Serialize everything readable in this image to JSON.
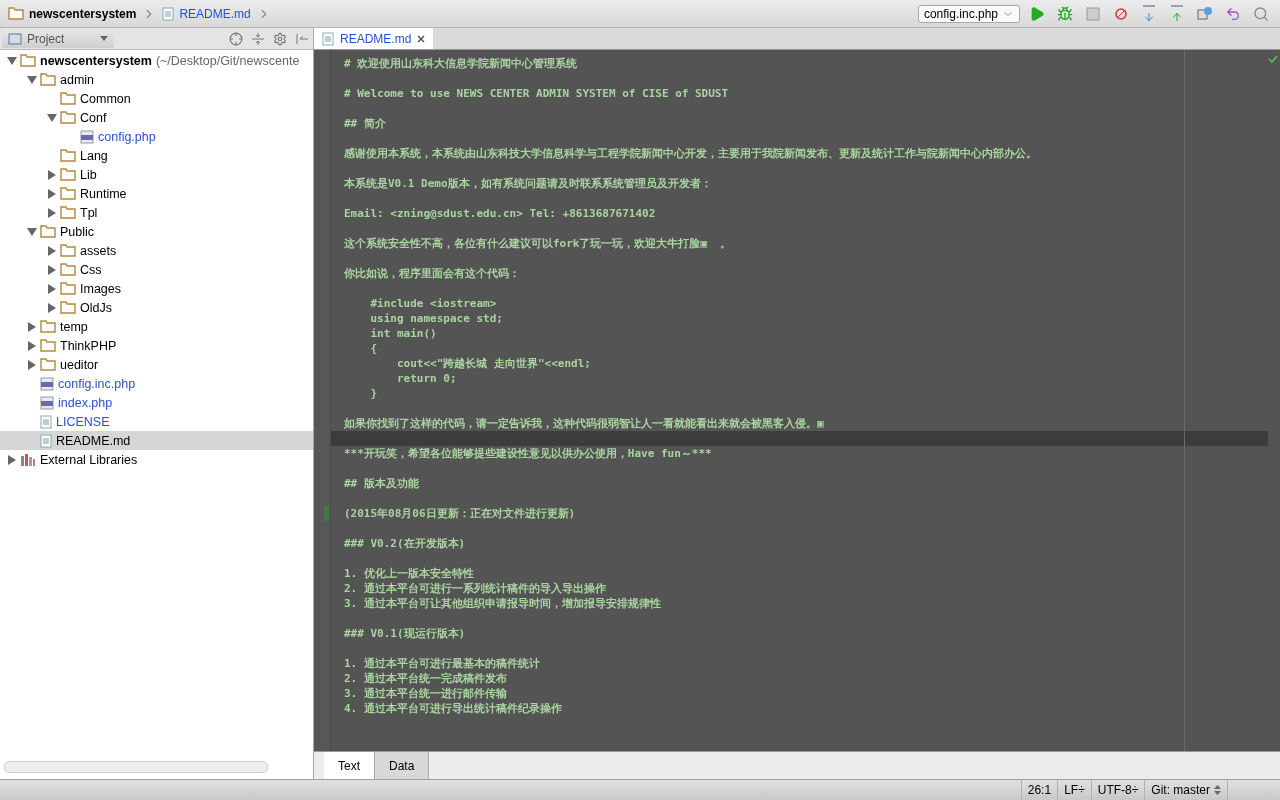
{
  "breadcrumb": [
    {
      "label": "newscentersystem",
      "kind": "folder"
    },
    {
      "label": "README.md",
      "kind": "file"
    }
  ],
  "run_config": {
    "label": "config.inc.php"
  },
  "project_panel": {
    "title": "Project"
  },
  "tree": [
    {
      "label": "newscentersystem",
      "path": "(~/Desktop/Git/newscente",
      "kind": "root",
      "expanded": true,
      "selected": false,
      "children": [
        {
          "label": "admin",
          "kind": "folder",
          "expanded": true,
          "selected": false,
          "children": [
            {
              "label": "Common",
              "kind": "folder",
              "selected": false
            },
            {
              "label": "Conf",
              "kind": "folder",
              "expanded": true,
              "selected": false,
              "children": [
                {
                  "label": "config.php",
                  "kind": "php",
                  "selected": false
                }
              ]
            },
            {
              "label": "Lang",
              "kind": "folder",
              "selected": false
            },
            {
              "label": "Lib",
              "kind": "folder",
              "expanded": false,
              "selected": false
            },
            {
              "label": "Runtime",
              "kind": "folder",
              "expanded": false,
              "selected": false
            },
            {
              "label": "Tpl",
              "kind": "folder",
              "expanded": false,
              "selected": false
            }
          ]
        },
        {
          "label": "Public",
          "kind": "folder",
          "expanded": true,
          "selected": false,
          "children": [
            {
              "label": "assets",
              "kind": "folder",
              "expanded": false,
              "selected": false
            },
            {
              "label": "Css",
              "kind": "folder",
              "expanded": false,
              "selected": false
            },
            {
              "label": "Images",
              "kind": "folder",
              "expanded": false,
              "selected": false
            },
            {
              "label": "OldJs",
              "kind": "folder",
              "expanded": false,
              "selected": false
            }
          ]
        },
        {
          "label": "temp",
          "kind": "folder",
          "expanded": false,
          "selected": false
        },
        {
          "label": "ThinkPHP",
          "kind": "folder",
          "expanded": false,
          "selected": false
        },
        {
          "label": "ueditor",
          "kind": "folder",
          "expanded": false,
          "selected": false
        },
        {
          "label": "config.inc.php",
          "kind": "php",
          "selected": false
        },
        {
          "label": "index.php",
          "kind": "php",
          "selected": false
        },
        {
          "label": "LICENSE",
          "kind": "text",
          "selected": false
        },
        {
          "label": "README.md",
          "kind": "md",
          "selected": true
        }
      ]
    },
    {
      "label": "External Libraries",
      "kind": "library",
      "expanded": false,
      "selected": false
    }
  ],
  "editor_tabs": [
    {
      "label": "README.md",
      "selected": true
    }
  ],
  "lines": [
    {
      "kind": "text",
      "text": "# 欢迎使用山东科大信息学院新闻中心管理系统"
    },
    {
      "kind": "blank"
    },
    {
      "kind": "text",
      "text": "# Welcome to use NEWS CENTER ADMIN SYSTEM of CISE of SDUST"
    },
    {
      "kind": "blank"
    },
    {
      "kind": "text",
      "text": "## 简介"
    },
    {
      "kind": "blank"
    },
    {
      "kind": "text",
      "text": "感谢使用本系统，本系统由山东科技大学信息科学与工程学院新闻中心开发，主要用于我院新闻发布、更新及统计工作与院新闻中心内部办公。"
    },
    {
      "kind": "blank"
    },
    {
      "kind": "text",
      "text": "本系统是V0.1 Demo版本，如有系统问题请及时联系系统管理员及开发者："
    },
    {
      "kind": "blank"
    },
    {
      "kind": "text",
      "text": "Email: <zning@sdust.edu.cn> Tel: +8613687671402"
    },
    {
      "kind": "blank"
    },
    {
      "kind": "text",
      "text": "这个系统安全性不高，各位有什么建议可以fork了玩一玩，欢迎大牛打脸▣  。"
    },
    {
      "kind": "blank"
    },
    {
      "kind": "text",
      "text": "你比如说，程序里面会有这个代码："
    },
    {
      "kind": "blank"
    },
    {
      "kind": "code",
      "text": "    #include <iostream>"
    },
    {
      "kind": "code",
      "text": "    using namespace std;"
    },
    {
      "kind": "code",
      "text": "    int main()"
    },
    {
      "kind": "code",
      "text": "    {"
    },
    {
      "kind": "code",
      "text": "        cout<<\"跨越长城 走向世界\"<<endl;"
    },
    {
      "kind": "code",
      "text": "        return 0;"
    },
    {
      "kind": "code",
      "text": "    }"
    },
    {
      "kind": "blank"
    },
    {
      "kind": "text",
      "text": "如果你找到了这样的代码，请一定告诉我，这种代码很弱智让人一看就能看出来就会被黑客入侵。▣"
    },
    {
      "kind": "blank",
      "current": true
    },
    {
      "kind": "text",
      "text": "***开玩笑，希望各位能够提些建设性意见以供办公使用，Have fun～***"
    },
    {
      "kind": "blank"
    },
    {
      "kind": "text",
      "text": "## 版本及功能"
    },
    {
      "kind": "blank"
    },
    {
      "kind": "text",
      "text": "(2015年08月06日更新：正在对文件进行更新)",
      "changed": true
    },
    {
      "kind": "blank"
    },
    {
      "kind": "text",
      "text": "### V0.2(在开发版本)"
    },
    {
      "kind": "blank"
    },
    {
      "kind": "text",
      "text": "1. 优化上一版本安全特性"
    },
    {
      "kind": "text",
      "text": "2. 通过本平台可进行一系列统计稿件的导入导出操作"
    },
    {
      "kind": "text",
      "text": "3. 通过本平台可让其他组织申请报导时间，增加报导安排规律性"
    },
    {
      "kind": "blank"
    },
    {
      "kind": "text",
      "text": "### V0.1(现运行版本)"
    },
    {
      "kind": "blank"
    },
    {
      "kind": "text",
      "text": "1. 通过本平台可进行最基本的稿件统计"
    },
    {
      "kind": "text",
      "text": "2. 通过本平台统一完成稿件发布"
    },
    {
      "kind": "text",
      "text": "3. 通过本平台统一进行邮件传输"
    },
    {
      "kind": "text",
      "text": "4. 通过本平台可进行导出统计稿件纪录操作"
    }
  ],
  "bottom_tabs": [
    {
      "label": "Text",
      "selected": true
    },
    {
      "label": "Data",
      "selected": false
    }
  ],
  "status_bar": {
    "position": "26:1",
    "line_separator": "LF÷",
    "encoding": "UTF-8÷",
    "vcs": "Git: master"
  }
}
